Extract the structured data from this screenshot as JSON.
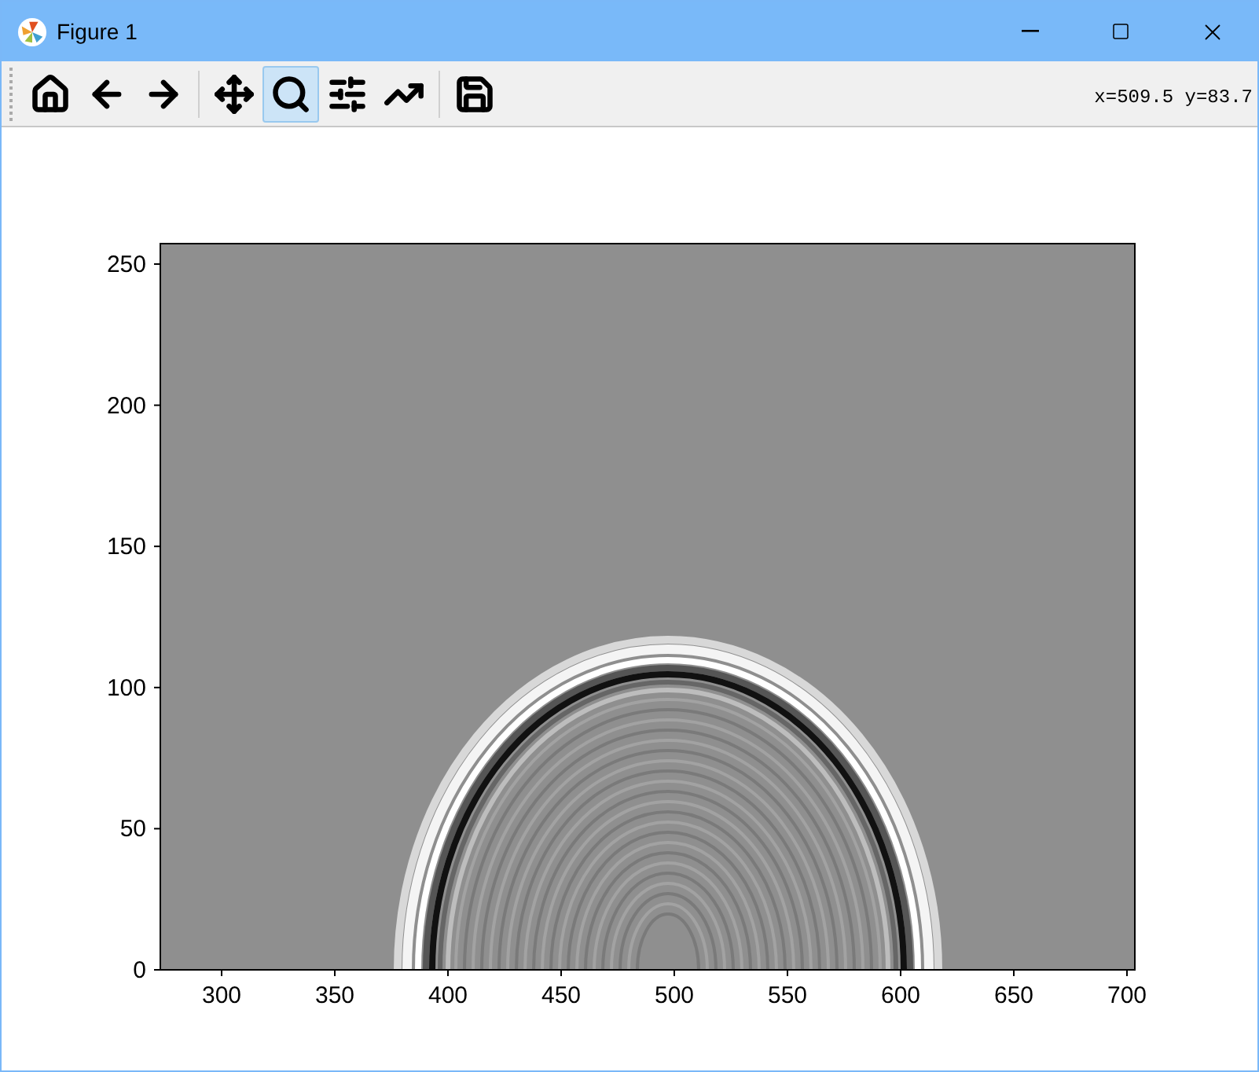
{
  "window": {
    "title": "Figure 1"
  },
  "toolbar": {
    "tools": [
      {
        "kind": "home",
        "selected": false
      },
      {
        "kind": "back",
        "selected": false
      },
      {
        "kind": "forward",
        "selected": false
      },
      {
        "kind": "pan",
        "selected": false
      },
      {
        "kind": "zoom",
        "selected": true
      },
      {
        "kind": "configure",
        "selected": false
      },
      {
        "kind": "edit",
        "selected": false
      },
      {
        "kind": "save",
        "selected": false
      }
    ],
    "coordinates": "x=509.5 y=83.7"
  },
  "plot": {
    "x_ticks": [
      "300",
      "350",
      "400",
      "450",
      "500",
      "550",
      "600",
      "650",
      "700"
    ],
    "y_ticks": [
      "250",
      "200",
      "150",
      "100",
      "50",
      "0"
    ]
  }
}
